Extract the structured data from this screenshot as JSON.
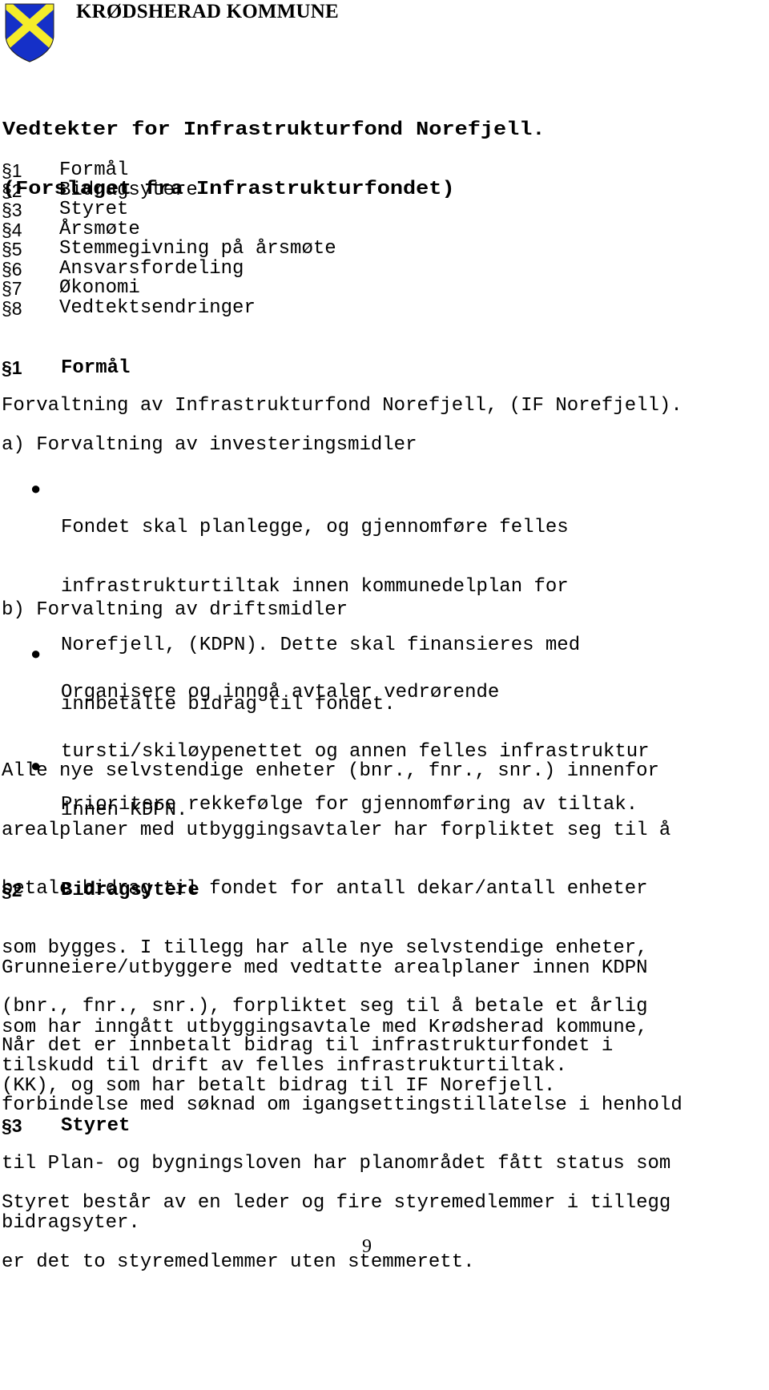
{
  "header": {
    "organization": "KRØDSHERAD KOMMUNE",
    "logo": "coat-of-arms-icon",
    "logo_colors": {
      "field": "#1530c8",
      "saltire": "#f5ec2a"
    }
  },
  "title": {
    "line1": "Vedtekter for Infrastrukturfond Norefjell.",
    "line2": "(Forslaget fra Infrastrukturfondet)"
  },
  "toc": [
    {
      "num": "§1",
      "label": "Formål"
    },
    {
      "num": "§2",
      "label": "Bidragsytere"
    },
    {
      "num": "§3",
      "label": "Styret"
    },
    {
      "num": "§4",
      "label": "Årsmøte"
    },
    {
      "num": "§5",
      "label": "Stemmegivning på årsmøte"
    },
    {
      "num": "§6",
      "label": "Ansvarsfordeling"
    },
    {
      "num": "§7",
      "label": "Økonomi"
    },
    {
      "num": "§8",
      "label": "Vedtektsendringer"
    }
  ],
  "sections": {
    "s1": {
      "num": "§1",
      "title": "Formål",
      "intro": "Forvaltning av Infrastrukturfond Norefjell, (IF Norefjell).",
      "a_label": "a) Forvaltning av investeringsmidler",
      "a_bullets": [
        [
          "Fondet skal planlegge, og gjennomføre felles",
          "infrastrukturtiltak innen kommunedelplan for",
          "Norefjell, (KDPN). Dette skal finansieres med",
          "innbetalte bidrag til fondet."
        ],
        [
          "Prioritere rekkefølge for gjennomføring av tiltak."
        ]
      ],
      "b_label": "b) Forvaltning av driftsmidler",
      "b_bullets": [
        [
          "Organisere og inngå avtaler vedrørende",
          "tursti/skiløypenettet og annen felles infrastruktur",
          "innen KDPN."
        ]
      ],
      "closing": [
        "Alle nye selvstendige enheter (bnr., fnr., snr.) innenfor",
        "arealplaner med utbyggingsavtaler har forpliktet seg til å",
        "betale bidrag til fondet for antall dekar/antall enheter",
        "som bygges. I tillegg har alle nye selvstendige enheter,",
        "(bnr., fnr., snr.), forpliktet seg til å betale et årlig",
        "tilskudd til drift av felles infrastrukturtiltak."
      ]
    },
    "s2": {
      "num": "§2",
      "title": "Bidragsytere",
      "para1": [
        "Grunneiere/utbyggere med vedtatte arealplaner innen KDPN",
        "som har inngått utbyggingsavtale med Krødsherad kommune,",
        "(KK), og som har betalt bidrag til IF Norefjell."
      ],
      "para2": [
        "Når det er innbetalt bidrag til infrastrukturfondet i",
        "forbindelse med søknad om igangsettingstillatelse i henhold",
        "til Plan- og bygningsloven har planområdet fått status som",
        "bidragsyter."
      ]
    },
    "s3": {
      "num": "§3",
      "title": "Styret",
      "para1": [
        "Styret består av en leder og fire styremedlemmer i tillegg",
        "er det to styremedlemmer uten stemmerett."
      ]
    }
  },
  "footer": {
    "page_number": "9"
  }
}
